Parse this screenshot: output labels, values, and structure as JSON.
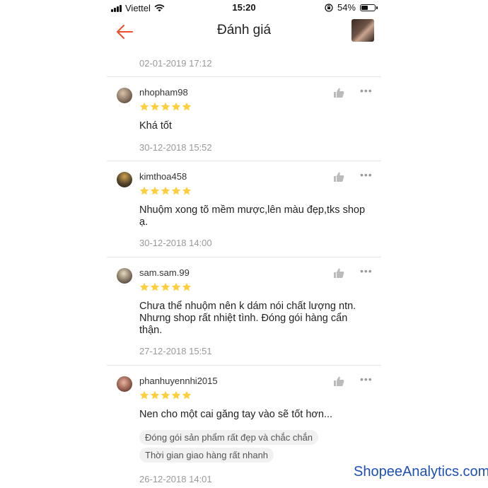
{
  "status_bar": {
    "carrier": "Viettel",
    "time": "15:20",
    "battery": "54%",
    "battery_level": 0.54
  },
  "header": {
    "title": "Đánh giá"
  },
  "top_partial": {
    "date": "02-01-2019 17:12"
  },
  "reviews": [
    {
      "username": "nhopham98",
      "rating": 5,
      "text": "Khá tốt",
      "date": "30-12-2018 15:52",
      "tags": []
    },
    {
      "username": "kimthoa458",
      "rating": 5,
      "text": "Nhuộm xong tõ mềm mược,lên màu đẹp,tks shop ạ.",
      "date": "30-12-2018 14:00",
      "tags": []
    },
    {
      "username": "sam.sam.99",
      "rating": 5,
      "text": "Chưa thể nhuộm nên k dám nói chất lượng ntn. Nhưng shop rất nhiệt tình. Đóng gói hàng cẩn thận.",
      "date": "27-12-2018 15:51",
      "tags": []
    },
    {
      "username": "phanhuyennhi2015",
      "rating": 5,
      "text": "Nen cho một cai găng tay vào sẽ tốt hơn...",
      "date": "26-12-2018 14:01",
      "tags": [
        "Đóng gói sản phẩm rất đẹp và chắc chắn",
        "Thời gian giao hàng rất nhanh"
      ]
    }
  ],
  "icons": {
    "like": "thumbs-up-icon",
    "more": "more-dots-icon",
    "star": "star-icon",
    "back": "back-arrow-icon"
  },
  "more_label": "•••",
  "colors": {
    "accent": "#ee4d2d",
    "star": "#ffce3d",
    "date": "#999999",
    "watermark": "#1d4fb8"
  },
  "watermark": "ShopeeAnalytics.com"
}
